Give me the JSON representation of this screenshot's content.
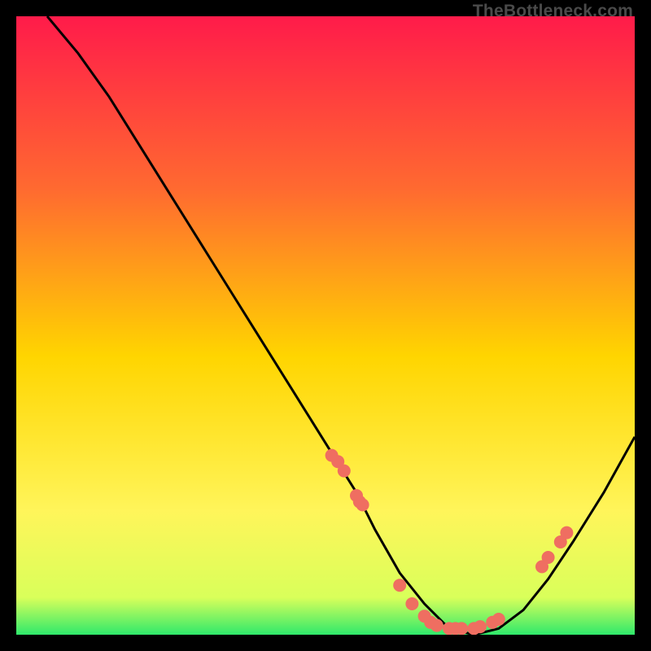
{
  "watermark": "TheBottleneck.com",
  "colors": {
    "bg_black": "#000000",
    "grad_top": "#ff1b4a",
    "grad_mid1": "#ff7a2a",
    "grad_mid2": "#ffd500",
    "grad_mid3": "#fff55a",
    "grad_bottom": "#2fe96b",
    "curve": "#000000",
    "dot": "#ef6e61"
  },
  "chart_data": {
    "type": "line",
    "title": "",
    "xlabel": "",
    "ylabel": "",
    "xlim": [
      0,
      100
    ],
    "ylim": [
      0,
      100
    ],
    "series": [
      {
        "name": "bottleneck-curve",
        "x": [
          5,
          10,
          15,
          20,
          25,
          30,
          35,
          40,
          45,
          50,
          55,
          58,
          62,
          66,
          70,
          74,
          78,
          82,
          86,
          90,
          95,
          100
        ],
        "y": [
          100,
          94,
          87,
          79,
          71,
          63,
          55,
          47,
          39,
          31,
          23,
          17,
          10,
          5,
          1,
          0,
          1,
          4,
          9,
          15,
          23,
          32
        ]
      }
    ],
    "points_on_curve": [
      {
        "name": "cluster-left",
        "x": [
          51,
          52,
          53,
          55,
          55.5,
          56
        ],
        "y": [
          29,
          28,
          26.5,
          22.5,
          21.5,
          21
        ]
      },
      {
        "name": "cluster-valley",
        "x": [
          62,
          64,
          66,
          67,
          68,
          70,
          71,
          72,
          74,
          75,
          77,
          78
        ],
        "y": [
          8,
          5,
          3,
          2,
          1.5,
          1,
          1,
          1,
          1,
          1.3,
          2,
          2.5
        ]
      },
      {
        "name": "cluster-right",
        "x": [
          85,
          86,
          88,
          89
        ],
        "y": [
          11,
          12.5,
          15,
          16.5
        ]
      }
    ],
    "gradient_stops": [
      {
        "offset": 0.0,
        "color": "#ff1b4a"
      },
      {
        "offset": 0.28,
        "color": "#ff6a30"
      },
      {
        "offset": 0.55,
        "color": "#ffd500"
      },
      {
        "offset": 0.8,
        "color": "#fff55a"
      },
      {
        "offset": 0.94,
        "color": "#d9ff5a"
      },
      {
        "offset": 1.0,
        "color": "#2fe96b"
      }
    ]
  }
}
